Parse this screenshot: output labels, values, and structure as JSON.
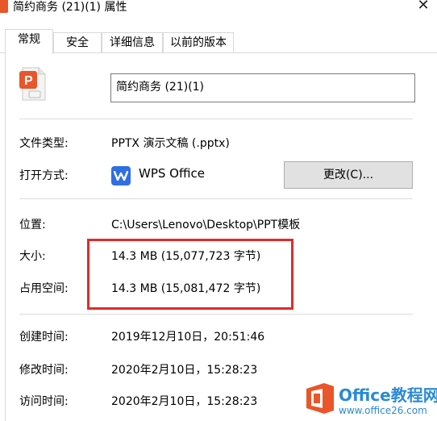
{
  "window": {
    "title": "简约商务 (21)(1) 属性",
    "close_glyph": "✕"
  },
  "tabs": [
    {
      "label": "常规",
      "active": true
    },
    {
      "label": "安全",
      "active": false
    },
    {
      "label": "详细信息",
      "active": false
    },
    {
      "label": "以前的版本",
      "active": false
    }
  ],
  "general": {
    "file_name": "简约商务 (21)(1)",
    "file_icon": "pptx-file-icon",
    "type_label": "文件类型:",
    "type_value": "PPTX 演示文稿 (.pptx)",
    "open_with_label": "打开方式:",
    "open_with_app": "WPS Office",
    "app_icon": "wps-icon",
    "change_button": "更改(C)...",
    "location_label": "位置:",
    "location_value": "C:\\Users\\Lenovo\\Desktop\\PPT模板",
    "size_label": "大小:",
    "size_value": "14.3 MB (15,077,723 字节)",
    "disk_size_label": "占用空间:",
    "disk_size_value": "14.3 MB (15,081,472 字节)",
    "created_label": "创建时间:",
    "created_value": "2019年12月10日，20:51:46",
    "modified_label": "修改时间:",
    "modified_value": "2020年2月10日，15:28:23",
    "accessed_label": "访问时间:",
    "accessed_value": "2020年2月10日，15:28:23"
  },
  "annotation": {
    "color": "#e02b2b"
  },
  "watermark": {
    "title": "Office教程网",
    "url": "www.office26.com",
    "icon": "office-logo-icon"
  }
}
